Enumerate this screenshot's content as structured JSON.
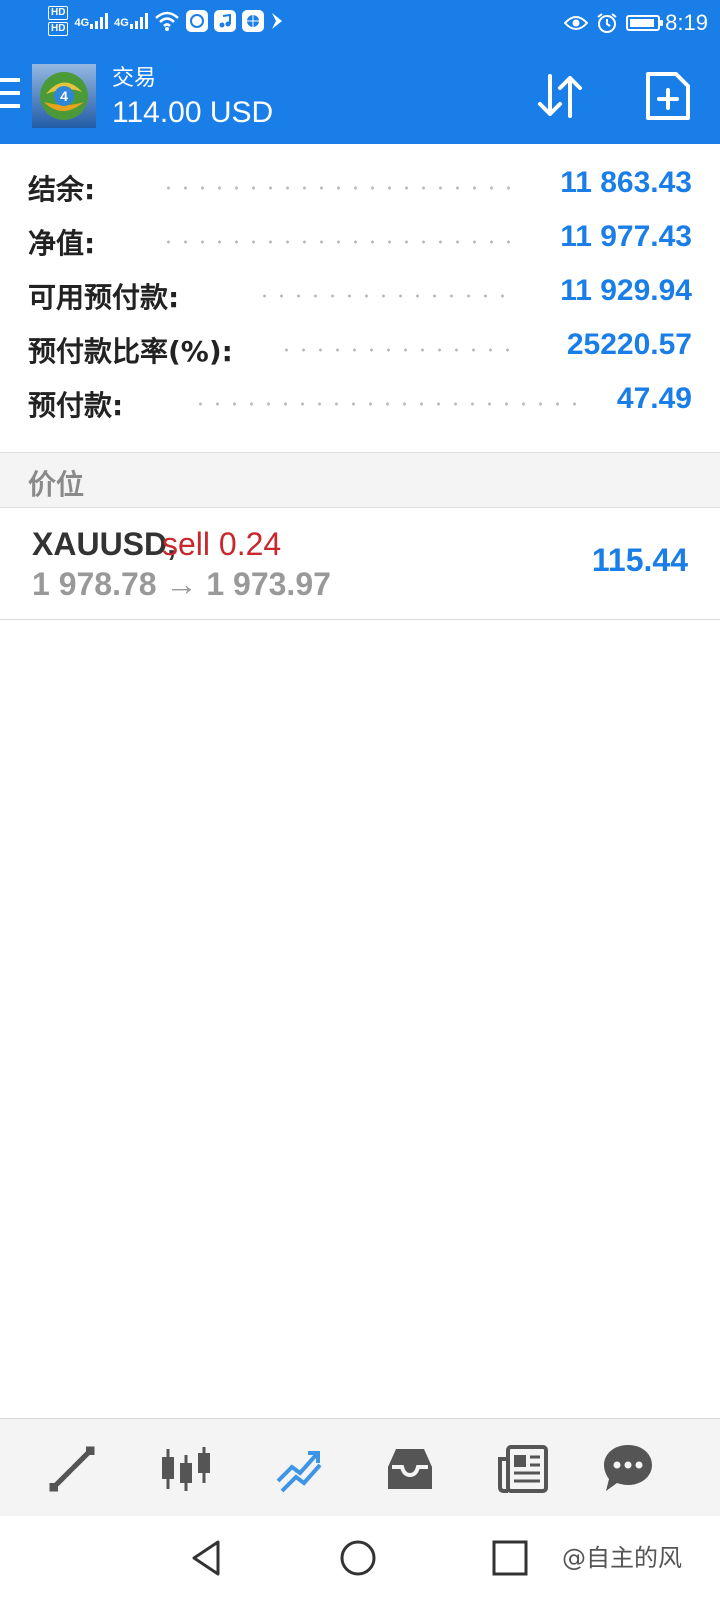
{
  "status_bar": {
    "time": "8:19",
    "hd1": "HD",
    "hd2": "HD",
    "net1": "4G",
    "net2": "4G"
  },
  "header": {
    "title": "交易",
    "balance": "114.00 USD"
  },
  "summary": [
    {
      "label": "结余:",
      "value": "11 863.43"
    },
    {
      "label": "净值:",
      "value": "11 977.43"
    },
    {
      "label": "可用预付款:",
      "value": "11 929.94"
    },
    {
      "label": "预付款比率(%):",
      "value": "25220.57"
    },
    {
      "label": "预付款:",
      "value": "47.49"
    }
  ],
  "section_header": "价位",
  "position": {
    "symbol": "XAUUSD,",
    "side": "sell 0.24",
    "prices": "1 978.78 → 1 973.97",
    "profit": "115.44"
  },
  "bottom_nav": {
    "items": [
      "quotes-icon",
      "chart-icon",
      "trade-icon",
      "history-icon",
      "news-icon",
      "chat-icon"
    ],
    "active": "trade-icon"
  },
  "watermark": "@自主的风",
  "colors": {
    "accent": "#1a7ee8",
    "sell": "#c8282d",
    "muted": "#999999"
  }
}
